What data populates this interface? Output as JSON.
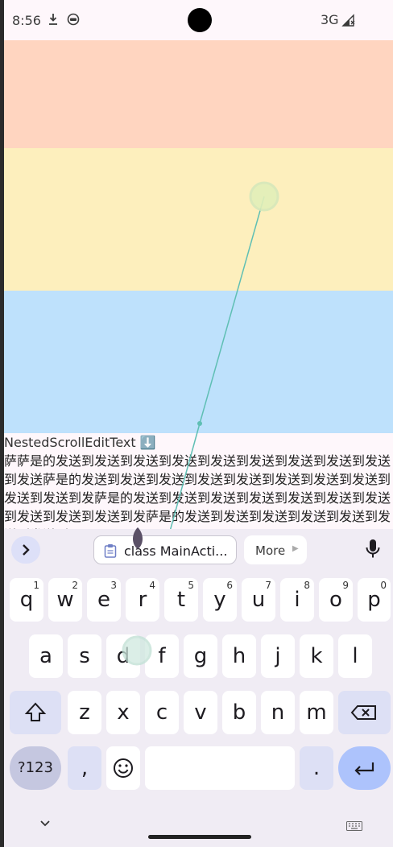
{
  "status_bar": {
    "time": "8:56",
    "icons": [
      "download-icon",
      "robot-face-icon"
    ],
    "network": "3G",
    "signal_icon": "signal-no-data-icon"
  },
  "colors": {
    "block_orange": "#ffd5c0",
    "block_yellow": "#fdefbd",
    "block_blue": "#bee1fc",
    "keyboard_bg": "#f0ecf4",
    "enter_key": "#adc3fc"
  },
  "edit": {
    "title": "NestedScrollEditText ⬇️",
    "text": "萨萨是的发送到发送到发送到发送到发送到发送到发送到发送到发送到发送萨是的发送到发送到发送到发送到发送到发送到发送到发送到发送到发送到发萨是的发送到发送到发送到发送到发送到发送到发送到发送到发送到发送到发萨是的发送到发送到发送到发送到发送到发送到发送到"
  },
  "keyboard": {
    "clipboard_chip": "class MainActi...",
    "more_label": "More",
    "row1": [
      {
        "k": "q",
        "n": "1"
      },
      {
        "k": "w",
        "n": "2"
      },
      {
        "k": "e",
        "n": "3"
      },
      {
        "k": "r",
        "n": "4"
      },
      {
        "k": "t",
        "n": "5"
      },
      {
        "k": "y",
        "n": "6"
      },
      {
        "k": "u",
        "n": "7"
      },
      {
        "k": "i",
        "n": "8"
      },
      {
        "k": "o",
        "n": "9"
      },
      {
        "k": "p",
        "n": "0"
      }
    ],
    "row2": [
      "a",
      "s",
      "d",
      "f",
      "g",
      "h",
      "j",
      "k",
      "l"
    ],
    "row3": [
      "z",
      "x",
      "c",
      "v",
      "b",
      "n",
      "m"
    ],
    "symbols_label": "?123",
    "comma_label": ",",
    "period_label": "."
  }
}
